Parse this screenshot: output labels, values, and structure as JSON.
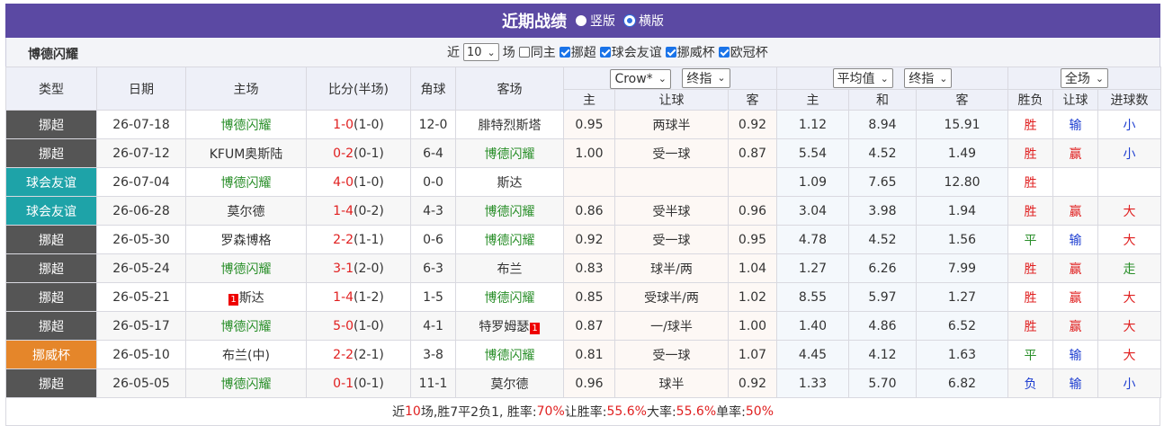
{
  "header": {
    "title": "近期战绩",
    "view_vertical": "竖版",
    "view_horizontal": "横版"
  },
  "filter": {
    "team": "博德闪耀",
    "recent_prefix": "近",
    "count": "10",
    "count_suffix": "场",
    "same_home": "同主",
    "comp1": "挪超",
    "comp2": "球会友谊",
    "comp3": "挪威杯",
    "comp4": "欧冠杯"
  },
  "columns": {
    "type": "类型",
    "date": "日期",
    "home": "主场",
    "score": "比分(半场)",
    "corner": "角球",
    "away": "客场",
    "company": "Crow*",
    "final1": "终指",
    "avg": "平均值",
    "final2": "终指",
    "scope": "全场",
    "h_home": "主",
    "h_handicap": "让球",
    "h_away": "客",
    "e_home": "主",
    "e_draw": "和",
    "e_away": "客",
    "r_result": "胜负",
    "r_handicap": "让球",
    "r_goals": "进球数"
  },
  "colors": {
    "header_bg": "#5b49a3",
    "type_league": "#555555",
    "type_friendly": "#1ea3a8",
    "type_cup": "#e5862a",
    "win": "#e02020",
    "draw": "#2a8f2a",
    "lose": "#1f3fd1"
  },
  "rows": [
    {
      "type": "挪超",
      "type_class": "t-dark",
      "date": "26-07-18",
      "home": "博德闪耀",
      "home_green": true,
      "home_badge": "",
      "score": "1-0",
      "half": "(1-0)",
      "corner": "12-0",
      "away": "腓特烈斯塔",
      "away_green": false,
      "away_badge": "",
      "ah_home": "0.95",
      "ah_line": "两球半",
      "ah_away": "0.92",
      "eu_home": "1.12",
      "eu_draw": "8.94",
      "eu_away": "15.91",
      "res": "胜",
      "res_c": "red",
      "hc": "输",
      "hc_c": "blue",
      "ou": "小",
      "ou_c": "blue"
    },
    {
      "type": "挪超",
      "type_class": "t-dark",
      "date": "26-07-12",
      "home": "KFUM奥斯陆",
      "home_green": false,
      "home_badge": "",
      "score": "0-2",
      "half": "(0-1)",
      "corner": "6-4",
      "away": "博德闪耀",
      "away_green": true,
      "away_badge": "",
      "ah_home": "1.00",
      "ah_line": "受一球",
      "ah_away": "0.87",
      "eu_home": "5.54",
      "eu_draw": "4.52",
      "eu_away": "1.49",
      "res": "胜",
      "res_c": "red",
      "hc": "赢",
      "hc_c": "red",
      "ou": "小",
      "ou_c": "blue"
    },
    {
      "type": "球会友谊",
      "type_class": "t-teal",
      "date": "26-07-04",
      "home": "博德闪耀",
      "home_green": true,
      "home_badge": "",
      "score": "4-0",
      "half": "(1-0)",
      "corner": "0-0",
      "away": "斯达",
      "away_green": false,
      "away_badge": "",
      "ah_home": "",
      "ah_line": "",
      "ah_away": "",
      "eu_home": "1.09",
      "eu_draw": "7.65",
      "eu_away": "12.80",
      "res": "胜",
      "res_c": "red",
      "hc": "",
      "hc_c": "",
      "ou": "",
      "ou_c": ""
    },
    {
      "type": "球会友谊",
      "type_class": "t-teal",
      "date": "26-06-28",
      "home": "莫尔德",
      "home_green": false,
      "home_badge": "",
      "score": "1-4",
      "half": "(0-2)",
      "corner": "4-3",
      "away": "博德闪耀",
      "away_green": true,
      "away_badge": "",
      "ah_home": "0.86",
      "ah_line": "受半球",
      "ah_away": "0.96",
      "eu_home": "3.04",
      "eu_draw": "3.98",
      "eu_away": "1.94",
      "res": "胜",
      "res_c": "red",
      "hc": "赢",
      "hc_c": "red",
      "ou": "大",
      "ou_c": "red"
    },
    {
      "type": "挪超",
      "type_class": "t-dark",
      "date": "26-05-30",
      "home": "罗森博格",
      "home_green": false,
      "home_badge": "",
      "score": "2-2",
      "half": "(1-1)",
      "corner": "0-6",
      "away": "博德闪耀",
      "away_green": true,
      "away_badge": "",
      "ah_home": "0.92",
      "ah_line": "受一球",
      "ah_away": "0.95",
      "eu_home": "4.78",
      "eu_draw": "4.52",
      "eu_away": "1.56",
      "res": "平",
      "res_c": "green",
      "hc": "输",
      "hc_c": "blue",
      "ou": "大",
      "ou_c": "red"
    },
    {
      "type": "挪超",
      "type_class": "t-dark",
      "date": "26-05-24",
      "home": "博德闪耀",
      "home_green": true,
      "home_badge": "",
      "score": "3-1",
      "half": "(2-0)",
      "corner": "6-3",
      "away": "布兰",
      "away_green": false,
      "away_badge": "",
      "ah_home": "0.83",
      "ah_line": "球半/两",
      "ah_away": "1.04",
      "eu_home": "1.27",
      "eu_draw": "6.26",
      "eu_away": "7.99",
      "res": "胜",
      "res_c": "red",
      "hc": "赢",
      "hc_c": "red",
      "ou": "走",
      "ou_c": "green"
    },
    {
      "type": "挪超",
      "type_class": "t-dark",
      "date": "26-05-21",
      "home": "斯达",
      "home_green": false,
      "home_badge": "1",
      "score": "1-4",
      "half": "(1-2)",
      "corner": "1-5",
      "away": "博德闪耀",
      "away_green": true,
      "away_badge": "",
      "ah_home": "0.85",
      "ah_line": "受球半/两",
      "ah_away": "1.02",
      "eu_home": "8.55",
      "eu_draw": "5.97",
      "eu_away": "1.27",
      "res": "胜",
      "res_c": "red",
      "hc": "赢",
      "hc_c": "red",
      "ou": "大",
      "ou_c": "red"
    },
    {
      "type": "挪超",
      "type_class": "t-dark",
      "date": "26-05-17",
      "home": "博德闪耀",
      "home_green": true,
      "home_badge": "",
      "score": "5-0",
      "half": "(1-0)",
      "corner": "4-1",
      "away": "特罗姆瑟",
      "away_green": false,
      "away_badge": "1",
      "ah_home": "0.87",
      "ah_line": "一/球半",
      "ah_away": "1.00",
      "eu_home": "1.40",
      "eu_draw": "4.86",
      "eu_away": "6.52",
      "res": "胜",
      "res_c": "red",
      "hc": "赢",
      "hc_c": "red",
      "ou": "大",
      "ou_c": "red"
    },
    {
      "type": "挪威杯",
      "type_class": "t-orange",
      "date": "26-05-10",
      "home": "布兰(中)",
      "home_green": false,
      "home_badge": "",
      "score": "2-2",
      "half": "(2-1)",
      "corner": "3-8",
      "away": "博德闪耀",
      "away_green": true,
      "away_badge": "",
      "ah_home": "0.81",
      "ah_line": "受一球",
      "ah_away": "1.07",
      "eu_home": "4.45",
      "eu_draw": "4.12",
      "eu_away": "1.63",
      "res": "平",
      "res_c": "green",
      "hc": "输",
      "hc_c": "blue",
      "ou": "大",
      "ou_c": "red"
    },
    {
      "type": "挪超",
      "type_class": "t-dark",
      "date": "26-05-05",
      "home": "博德闪耀",
      "home_green": true,
      "home_badge": "",
      "score": "0-1",
      "half": "(0-1)",
      "corner": "11-1",
      "away": "莫尔德",
      "away_green": false,
      "away_badge": "",
      "ah_home": "0.96",
      "ah_line": "球半",
      "ah_away": "0.92",
      "eu_home": "1.33",
      "eu_draw": "5.70",
      "eu_away": "6.82",
      "res": "负",
      "res_c": "blue",
      "hc": "输",
      "hc_c": "blue",
      "ou": "小",
      "ou_c": "blue"
    }
  ],
  "summary": {
    "p1": "近",
    "games": "10",
    "p2": "场,胜7平2负1, 胜率:",
    "win_rate": "70%",
    "p3": " 让胜率:",
    "hc_rate": "55.6%",
    "p4": " 大率:",
    "over_rate": "55.6%",
    "p5": " 单率:",
    "odd_rate": "50%"
  }
}
